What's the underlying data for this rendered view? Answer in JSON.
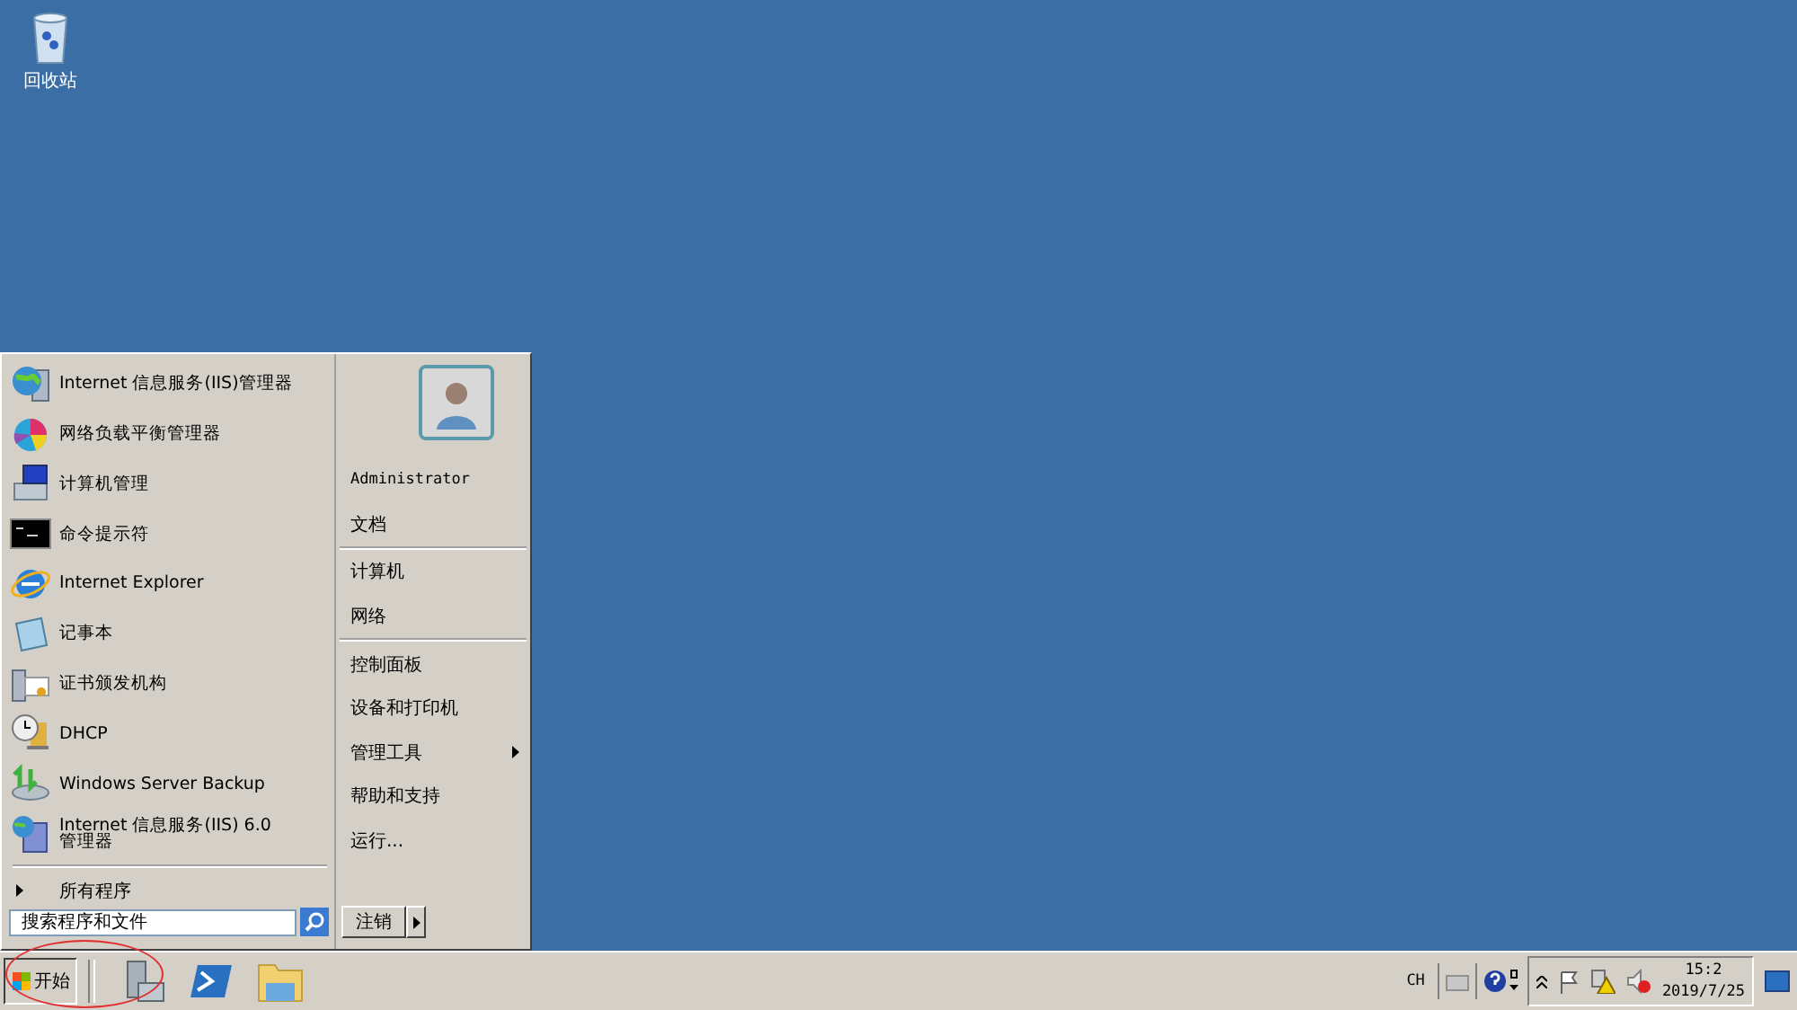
{
  "desktop": {
    "icons": [
      {
        "label": "回收站"
      }
    ]
  },
  "start_menu": {
    "programs": [
      {
        "label": "Internet 信息服务(IIS)管理器"
      },
      {
        "label": "网络负载平衡管理器"
      },
      {
        "label": "计算机管理"
      },
      {
        "label": "命令提示符"
      },
      {
        "label": "Internet Explorer"
      },
      {
        "label": "记事本"
      },
      {
        "label": "证书颁发机构"
      },
      {
        "label": "DHCP"
      },
      {
        "label": "Windows Server Backup"
      },
      {
        "label": "Internet 信息服务(IIS) 6.0 管理器"
      }
    ],
    "all_programs": "所有程序",
    "search": {
      "placeholder": "搜索程序和文件"
    },
    "places": [
      {
        "label": "Administrator",
        "kind": "user",
        "submenu": false
      },
      {
        "label": "文档",
        "kind": "item",
        "submenu": false,
        "separator_after": true
      },
      {
        "label": "计算机",
        "kind": "item",
        "submenu": false
      },
      {
        "label": "网络",
        "kind": "item",
        "submenu": false,
        "separator_after": true
      },
      {
        "label": "控制面板",
        "kind": "item",
        "submenu": false
      },
      {
        "label": "设备和打印机",
        "kind": "item",
        "submenu": false
      },
      {
        "label": "管理工具",
        "kind": "item",
        "submenu": true
      },
      {
        "label": "帮助和支持",
        "kind": "item",
        "submenu": false
      },
      {
        "label": "运行...",
        "kind": "item",
        "submenu": false
      }
    ],
    "logoff": "注销"
  },
  "taskbar": {
    "start": "开始",
    "language": "CH",
    "clock": {
      "time": "15:2",
      "date": "2019/7/25"
    }
  }
}
